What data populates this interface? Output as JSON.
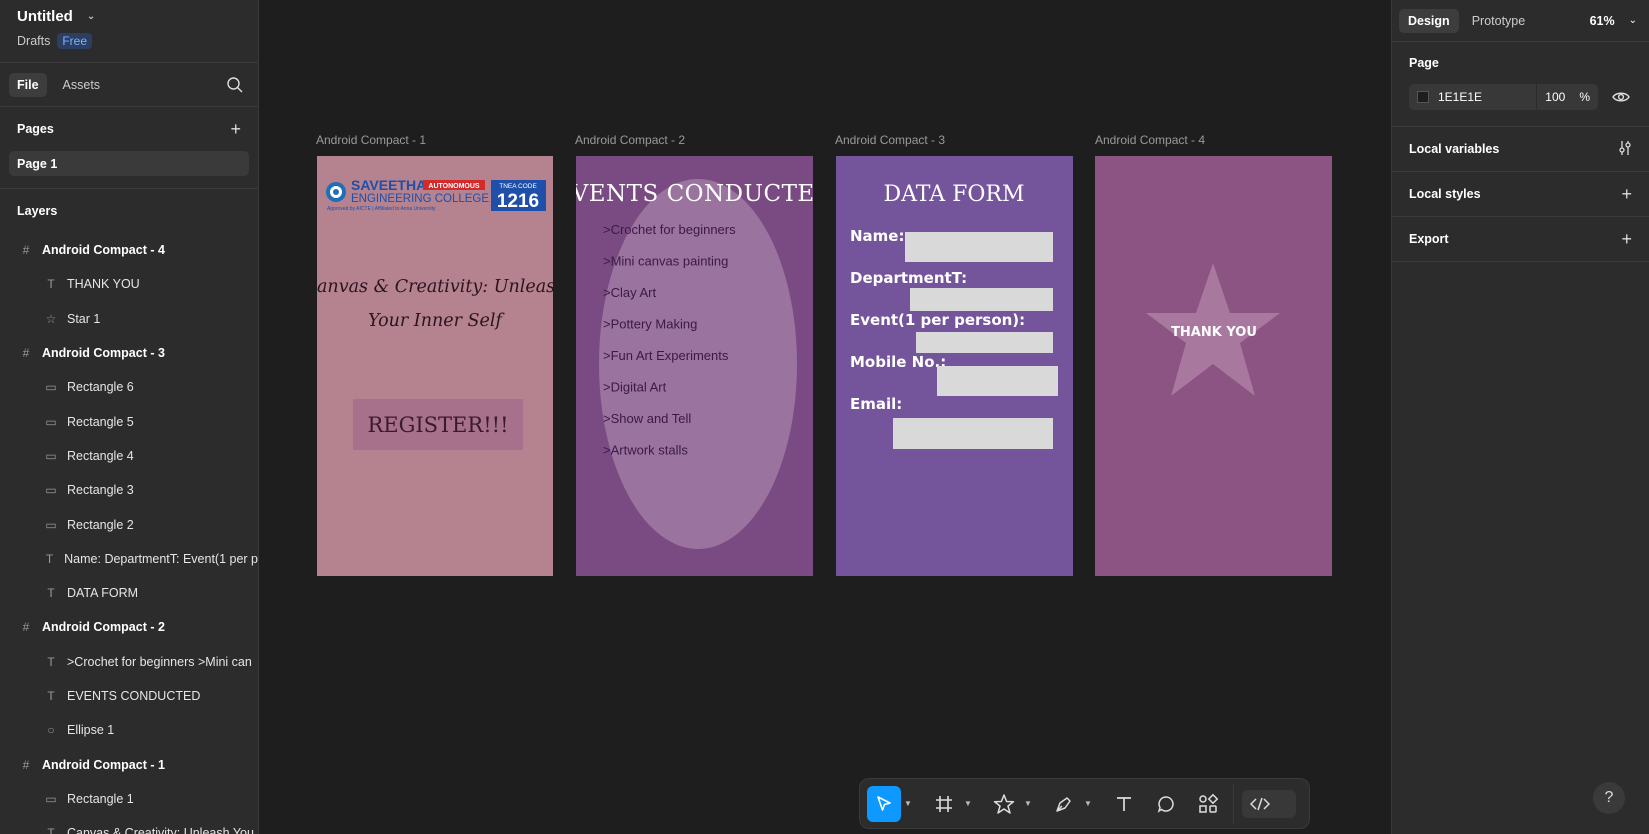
{
  "file": {
    "title": "Untitled",
    "location": "Drafts",
    "plan_badge": "Free"
  },
  "left_tabs": [
    "File",
    "Assets"
  ],
  "pages": {
    "heading": "Pages",
    "items": [
      "Page 1"
    ]
  },
  "layers": {
    "heading": "Layers",
    "items": [
      {
        "type": "frame",
        "label": "Android Compact - 4"
      },
      {
        "type": "text",
        "label": "THANK YOU"
      },
      {
        "type": "star",
        "label": "Star 1"
      },
      {
        "type": "frame",
        "label": "Android Compact - 3"
      },
      {
        "type": "rect",
        "label": "Rectangle 6"
      },
      {
        "type": "rect",
        "label": "Rectangle 5"
      },
      {
        "type": "rect",
        "label": "Rectangle 4"
      },
      {
        "type": "rect",
        "label": "Rectangle 3"
      },
      {
        "type": "rect",
        "label": "Rectangle 2"
      },
      {
        "type": "text",
        "label": "Name: DepartmentT: Event(1 per p"
      },
      {
        "type": "text",
        "label": "DATA FORM"
      },
      {
        "type": "frame",
        "label": "Android Compact - 2"
      },
      {
        "type": "text",
        "label": ">Crochet for beginners >Mini can"
      },
      {
        "type": "text",
        "label": "EVENTS CONDUCTED"
      },
      {
        "type": "ellipse",
        "label": "Ellipse 1"
      },
      {
        "type": "frame",
        "label": "Android Compact - 1"
      },
      {
        "type": "rect",
        "label": "Rectangle 1"
      },
      {
        "type": "text",
        "label": "Canvas & Creativity: Unleash You"
      }
    ]
  },
  "frames": {
    "f1": {
      "label": "Android Compact - 1",
      "bg": "#b5828f",
      "logo_name": "SAVEETHA",
      "logo_sub": "ENGINEERING COLLEGE",
      "logo_badge": "AUTONOMOUS",
      "logo_tag": "Approved by AICTE | Affiliated to Anna University",
      "logo_code_label": "TNEA CODE",
      "logo_code": "1216",
      "headline": "Canvas & Creativity: Unleash Your Inner Self",
      "button": "REGISTER!!!"
    },
    "f2": {
      "label": "Android Compact - 2",
      "bg": "#7a4b82",
      "title": "EVENTS CONDUCTED",
      "events": [
        ">Crochet for beginners",
        ">Mini canvas painting",
        ">Clay Art",
        ">Pottery Making",
        ">Fun Art Experiments",
        ">Digital Art",
        ">Show and Tell",
        ">Artwork stalls"
      ]
    },
    "f3": {
      "label": "Android Compact - 3",
      "bg": "#74559b",
      "title": "DATA FORM",
      "fields": [
        "Name:",
        "DepartmentT:",
        "Event(1 per person):",
        "Mobile No.:",
        "Email:"
      ]
    },
    "f4": {
      "label": "Android Compact - 4",
      "bg": "#8b5482",
      "text": "THANK YOU"
    }
  },
  "right_panel": {
    "tabs": [
      "Design",
      "Prototype"
    ],
    "zoom": "61%",
    "page_heading": "Page",
    "page_color": "1E1E1E",
    "page_opacity": "100",
    "percent": "%",
    "local_variables": "Local variables",
    "local_styles": "Local styles",
    "export": "Export"
  },
  "help": "?",
  "icons": [
    "search-icon",
    "plus-icon",
    "frame-icon",
    "text-icon",
    "star-icon",
    "rectangle-icon",
    "ellipse-icon",
    "eye-icon",
    "move-icon",
    "pen-icon",
    "comment-icon",
    "actions-icon",
    "dev-mode-icon"
  ]
}
